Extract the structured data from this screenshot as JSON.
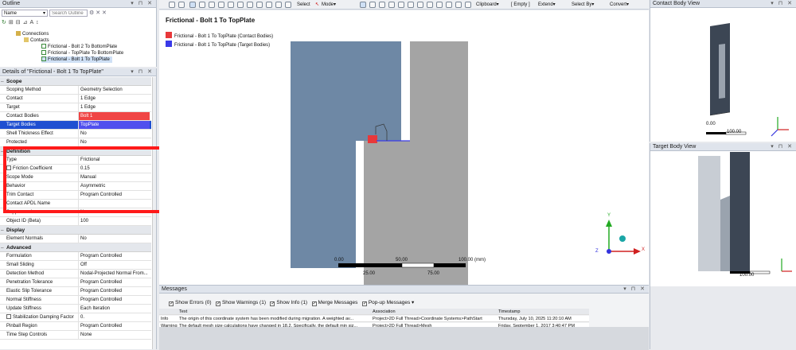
{
  "outline": {
    "title": "Outline",
    "name_filter": "Name",
    "search_placeholder": "Search Outline",
    "tree": [
      {
        "label": "Connections",
        "indent": 1,
        "icon": "connections-icon"
      },
      {
        "label": "Contacts",
        "indent": 2,
        "icon": "contacts-folder-icon"
      },
      {
        "label": "Frictional - Bolt 2 To BottomPlate",
        "indent": 3,
        "icon": "contact-icon"
      },
      {
        "label": "Frictional - TopPlate To BottomPlate",
        "indent": 3,
        "icon": "contact-icon"
      },
      {
        "label": "Frictional - Bolt 1 To TopPlate",
        "indent": 3,
        "icon": "contact-icon",
        "selected": true
      }
    ]
  },
  "details": {
    "title": "Details of \"Frictional - Bolt 1 To TopPlate\"",
    "rows": [
      {
        "type": "section",
        "label": "Scope"
      },
      {
        "key": "Scoping Method",
        "value": "Geometry Selection"
      },
      {
        "key": "Contact",
        "value": "1 Edge"
      },
      {
        "key": "Target",
        "value": "1 Edge"
      },
      {
        "key": "Contact Bodies",
        "value": "Bolt 1",
        "hl": "contact"
      },
      {
        "key": "Target Bodies",
        "value": "TopPlate",
        "hl": "target"
      },
      {
        "key": "Shell Thickness Effect",
        "value": "No"
      },
      {
        "key": "Protected",
        "value": "No"
      },
      {
        "type": "section",
        "label": "Definition"
      },
      {
        "key": "Type",
        "value": "Frictional"
      },
      {
        "key": "Friction Coefficient",
        "value": "0.15",
        "check": true
      },
      {
        "key": "Scope Mode",
        "value": "Manual"
      },
      {
        "key": "Behavior",
        "value": "Asymmetric"
      },
      {
        "key": "Trim Contact",
        "value": "Program Controlled"
      },
      {
        "key": "Contact APDL Name",
        "value": ""
      },
      {
        "key": "Suppressed",
        "value": "No"
      },
      {
        "key": "Object ID (Beta)",
        "value": "100"
      },
      {
        "type": "section",
        "label": "Display"
      },
      {
        "key": "Element Normals",
        "value": "No"
      },
      {
        "type": "section",
        "label": "Advanced"
      },
      {
        "key": "Formulation",
        "value": "Program Controlled"
      },
      {
        "key": "Small Sliding",
        "value": "Off"
      },
      {
        "key": "Detection Method",
        "value": "Nodal-Projected Normal From..."
      },
      {
        "key": "Penetration Tolerance",
        "value": "Program Controlled"
      },
      {
        "key": "Elastic Slip Tolerance",
        "value": "Program Controlled"
      },
      {
        "key": "Normal Stiffness",
        "value": "Program Controlled"
      },
      {
        "key": "Update Stiffness",
        "value": "Each Iteration"
      },
      {
        "key": "Stabilization Damping Factor",
        "value": "0.",
        "check": true
      },
      {
        "key": "Pinball Region",
        "value": "Program Controlled"
      },
      {
        "key": "Time Step Controls",
        "value": "None"
      }
    ]
  },
  "toolbar": {
    "select_label": "Select",
    "mode_label": "Mode▾",
    "clipboard_label": "Clipboard▾",
    "empty_label": "[ Empty ]",
    "extend_label": "Extend▾",
    "select_by_label": "Select By▾",
    "convert_label": "Convert▾"
  },
  "viewport": {
    "title": "Frictional - Bolt 1 To TopPlate",
    "legend": [
      {
        "label": "Frictional - Bolt 1 To TopPlate (Contact Bodies)",
        "color": "#e8383a"
      },
      {
        "label": "Frictional - Bolt 1 To TopPlate (Target Bodies)",
        "color": "#3a3ae8"
      }
    ],
    "scale": {
      "top_labels": [
        "0.00",
        "50.00",
        "100.00 (mm)"
      ],
      "bottom_labels": [
        "25.00",
        "75.00"
      ]
    },
    "triad": {
      "x": "X",
      "y": "Y",
      "z": "Z"
    }
  },
  "messages": {
    "title": "Messages",
    "filters": [
      {
        "label": "Show Errors",
        "count": "(0)"
      },
      {
        "label": "Show Warnings",
        "count": "(1)"
      },
      {
        "label": "Show Info",
        "count": "(1)"
      },
      {
        "label": "Merge Messages",
        "count": ""
      },
      {
        "label": "Pop-up Messages",
        "count": ""
      }
    ],
    "columns": [
      "",
      "Text",
      "Association",
      "Timestamp"
    ],
    "rows": [
      [
        "Info",
        "The origin of this coordinate system has been modified during migration. A weighted av...",
        "Project>2D Full Thread>Coordinate Systems>PathStart",
        "Thursday, July 10, 2025 11:20:10 AM"
      ],
      [
        "Warning",
        "The default mesh size calculations have changed in 18.2. Specifically, the default min siz...",
        "Project>2D Full Thread>Mesh",
        "Friday, September 1, 2017 3:40:47 PM"
      ]
    ]
  },
  "contact_view": {
    "title": "Contact Body View",
    "scale_left": "0.00",
    "scale_right": "100.00"
  },
  "target_view": {
    "title": "Target Body View",
    "scale_left": "0.00",
    "scale_right": "100.00"
  },
  "colors": {
    "contact": "#f04545",
    "target": "#5050ee",
    "plate": "#6e88a5",
    "bolt": "#a4a4a4",
    "highlight_box": "#ff1a1a"
  }
}
